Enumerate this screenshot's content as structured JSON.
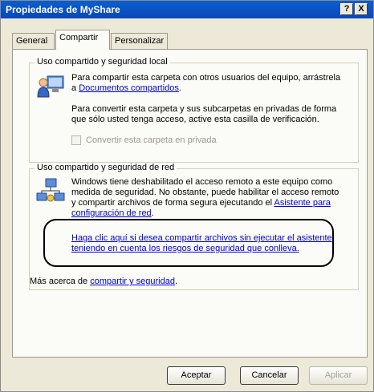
{
  "window": {
    "title": "Propiedades de MyShare",
    "help_label": "?",
    "close_label": "X"
  },
  "tabs": [
    {
      "label": "General"
    },
    {
      "label": "Compartir"
    },
    {
      "label": "Personalizar"
    }
  ],
  "local_group": {
    "legend": "Uso compartido y seguridad local",
    "line1": "Para compartir esta carpeta con otros usuarios del equipo, arrástrela",
    "line2_prefix": "a ",
    "line2_link": "Documentos compartidos",
    "line2_suffix": ".",
    "line3": "Para convertir esta carpeta y sus subcarpetas en privadas de forma",
    "line4": "que sólo usted tenga acceso, active esta casilla de verificación.",
    "checkbox_label": "Convertir esta carpeta en privada"
  },
  "network_group": {
    "legend": "Uso compartido y seguridad de red",
    "line1": "Windows tiene deshabilitado el acceso remoto a este equipo como",
    "line2": "medida de seguridad. No obstante, puede habilitar el acceso remoto",
    "line3_prefix": "y compartir archivos de forma segura ejecutando el ",
    "line3_link": "Asistente para",
    "line4_link": "configuración de red",
    "line4_suffix": ".",
    "risk_link1": "Haga clic aquí si desea compartir archivos sin ejecutar el asistente",
    "risk_link2": "teniendo en cuenta los riesgos de seguridad que conlleva."
  },
  "more": {
    "prefix": "Más acerca de ",
    "link": "compartir y seguridad",
    "suffix": "."
  },
  "buttons": {
    "ok": "Aceptar",
    "cancel": "Cancelar",
    "apply": "Aplicar"
  }
}
